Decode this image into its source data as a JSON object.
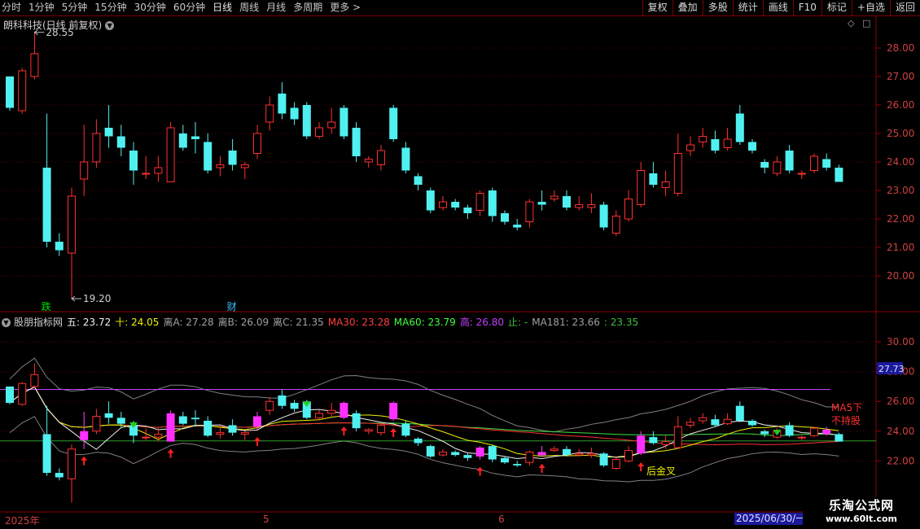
{
  "toolbar": {
    "periods": [
      "分时",
      "1分钟",
      "5分钟",
      "15分钟",
      "30分钟",
      "60分钟",
      "日线",
      "周线",
      "月线",
      "多周期",
      "更多 >"
    ],
    "active_period": "日线",
    "actions": [
      "复权",
      "叠加",
      "多股",
      "统计",
      "画线",
      "F10",
      "标记",
      "+自选",
      "返回"
    ]
  },
  "main": {
    "title": "朗科科技(日线 前复权)",
    "high_label": "28.55",
    "low_label": "19.20",
    "markers": [
      {
        "text": "跌",
        "color": "#00e000",
        "candle": 3
      },
      {
        "text": "财",
        "color": "#40c0ff",
        "candle": 18
      }
    ]
  },
  "indicator": {
    "name": "股朋指标网",
    "legend": [
      {
        "label": "五: 23.72",
        "color": "#f0f0f0"
      },
      {
        "label": "十: 24.05",
        "color": "#f0f000"
      },
      {
        "label": "离A: 27.28",
        "color": "#a0a0a0"
      },
      {
        "label": "离B: 26.09",
        "color": "#a0a0a0"
      },
      {
        "label": "离C: 21.35",
        "color": "#a0a0a0"
      },
      {
        "label": "MA30: 23.28",
        "color": "#ff4040"
      },
      {
        "label": "MA60: 23.79",
        "color": "#40ff40"
      },
      {
        "label": "高: 26.80",
        "color": "#c040ff"
      },
      {
        "label": "止: -",
        "color": "#40c040"
      },
      {
        "label": "MA181: 23.66",
        "color": "#a0a0a0"
      },
      {
        "label": ": 23.35",
        "color": "#40c040"
      }
    ],
    "annotations": {
      "ma5_text_line1": "MA5下",
      "ma5_text_line2": "不持股",
      "golden_cross": "后金叉"
    },
    "current_price_tag": "27.73"
  },
  "axis_main": [
    "28.00",
    "27.00",
    "26.00",
    "25.00",
    "24.00",
    "23.00",
    "22.00",
    "21.00",
    "20.00"
  ],
  "axis_sub": [
    "30.00",
    "28.00",
    "26.00",
    "24.00",
    "22.00"
  ],
  "dates": [
    {
      "label": "2025年",
      "left": 6
    },
    {
      "label": "5",
      "left": 323
    },
    {
      "label": "6",
      "left": 612
    }
  ],
  "date_cursor": "2025/06/30/一",
  "watermark": {
    "line1": "乐淘公式网",
    "line2": "www.60lt.com"
  },
  "chart_data": {
    "type": "candlestick",
    "title": "朗科科技(日线 前复权)",
    "y_range": [
      19.2,
      28.55
    ],
    "candles": [
      [
        27.0,
        25.9,
        27.0,
        25.8
      ],
      [
        25.8,
        27.2,
        27.3,
        25.7
      ],
      [
        27.0,
        27.8,
        28.55,
        26.9
      ],
      [
        23.8,
        21.2,
        25.7,
        21.0
      ],
      [
        21.2,
        20.9,
        21.5,
        20.7
      ],
      [
        20.8,
        22.8,
        23.1,
        19.2
      ],
      [
        23.4,
        24.0,
        25.3,
        22.8
      ],
      [
        24.0,
        25.0,
        25.5,
        23.8
      ],
      [
        25.2,
        24.9,
        26.0,
        24.5
      ],
      [
        24.9,
        24.5,
        25.3,
        24.2
      ],
      [
        24.4,
        23.7,
        24.7,
        23.2
      ],
      [
        23.6,
        23.6,
        24.2,
        23.4
      ],
      [
        23.6,
        23.8,
        24.2,
        23.3
      ],
      [
        23.3,
        25.2,
        25.4,
        23.3
      ],
      [
        25.0,
        24.5,
        25.3,
        24.4
      ],
      [
        24.9,
        24.8,
        25.4,
        24.3
      ],
      [
        24.7,
        23.7,
        25.0,
        23.6
      ],
      [
        23.8,
        23.9,
        24.2,
        23.5
      ],
      [
        24.4,
        23.9,
        24.8,
        23.7
      ],
      [
        23.8,
        23.9,
        24.0,
        23.4
      ],
      [
        24.3,
        25.0,
        25.3,
        24.1
      ],
      [
        25.4,
        26.0,
        26.3,
        25.1
      ],
      [
        26.4,
        25.7,
        26.8,
        25.5
      ],
      [
        25.9,
        25.5,
        26.1,
        25.3
      ],
      [
        26.0,
        24.9,
        26.1,
        24.8
      ],
      [
        24.9,
        25.2,
        25.4,
        24.8
      ],
      [
        25.2,
        25.4,
        25.9,
        25.0
      ],
      [
        25.9,
        24.9,
        26.0,
        24.8
      ],
      [
        25.2,
        24.2,
        25.4,
        24.0
      ],
      [
        24.0,
        24.1,
        24.2,
        23.8
      ],
      [
        23.9,
        24.4,
        24.6,
        23.7
      ],
      [
        25.9,
        24.8,
        26.0,
        24.7
      ],
      [
        24.5,
        23.7,
        24.7,
        23.6
      ],
      [
        23.5,
        23.2,
        23.6,
        23.0
      ],
      [
        23.0,
        22.3,
        23.1,
        22.2
      ],
      [
        22.4,
        22.6,
        22.8,
        22.3
      ],
      [
        22.6,
        22.4,
        22.7,
        22.3
      ],
      [
        22.4,
        22.2,
        22.5,
        22.0
      ],
      [
        22.3,
        22.9,
        23.0,
        22.1
      ],
      [
        23.0,
        22.1,
        23.1,
        21.9
      ],
      [
        22.2,
        21.9,
        22.3,
        21.8
      ],
      [
        21.8,
        21.7,
        22.0,
        21.6
      ],
      [
        21.9,
        22.6,
        22.7,
        21.7
      ],
      [
        22.6,
        22.5,
        23.0,
        22.3
      ],
      [
        22.7,
        22.8,
        23.0,
        22.6
      ],
      [
        22.8,
        22.4,
        23.0,
        22.3
      ],
      [
        22.4,
        22.5,
        22.8,
        22.3
      ],
      [
        22.4,
        22.5,
        22.9,
        22.2
      ],
      [
        22.5,
        21.7,
        22.6,
        21.6
      ],
      [
        21.5,
        22.1,
        22.3,
        21.4
      ],
      [
        22.0,
        22.7,
        23.0,
        21.9
      ],
      [
        22.5,
        23.7,
        24.0,
        22.4
      ],
      [
        23.6,
        23.2,
        24.0,
        23.1
      ],
      [
        23.1,
        23.3,
        23.7,
        22.8
      ],
      [
        22.9,
        24.3,
        25.0,
        22.8
      ],
      [
        24.4,
        24.6,
        24.9,
        24.2
      ],
      [
        24.7,
        24.9,
        25.2,
        24.5
      ],
      [
        24.8,
        24.4,
        25.1,
        24.3
      ],
      [
        24.5,
        24.8,
        25.2,
        24.4
      ],
      [
        25.7,
        24.7,
        26.0,
        24.6
      ],
      [
        24.7,
        24.4,
        24.8,
        24.3
      ],
      [
        24.0,
        23.8,
        24.1,
        23.6
      ],
      [
        23.6,
        24.0,
        24.2,
        23.5
      ],
      [
        24.4,
        23.7,
        24.6,
        23.6
      ],
      [
        23.6,
        23.6,
        23.7,
        23.4
      ],
      [
        23.7,
        24.2,
        24.3,
        23.6
      ],
      [
        24.1,
        23.8,
        24.3,
        23.7
      ],
      [
        23.8,
        23.3,
        23.9,
        23.3
      ]
    ],
    "sub_range": [
      18.5,
      31.5
    ],
    "sub_lines": [
      {
        "name": "五",
        "color": "#f0f0f0"
      },
      {
        "name": "十",
        "color": "#f0f000"
      },
      {
        "name": "MA30",
        "color": "#ff4040"
      },
      {
        "name": "MA60",
        "color": "#40ff40"
      },
      {
        "name": "高",
        "color": "#c040ff"
      },
      {
        "name": "离A",
        "color": "#909090"
      },
      {
        "name": "离C",
        "color": "#909090"
      }
    ],
    "high_line": 26.8,
    "green_level": 23.35,
    "buy_arrows": [
      6,
      13,
      20,
      27,
      31,
      38,
      43,
      51
    ],
    "sell_arrows": [
      10,
      24,
      62
    ],
    "magenta_candles": [
      6,
      13,
      20,
      27,
      31,
      38,
      43,
      51,
      66
    ]
  }
}
